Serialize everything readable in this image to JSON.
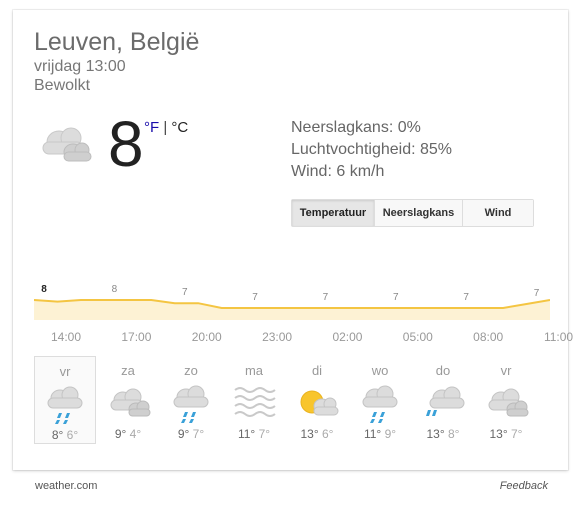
{
  "location": "Leuven, België",
  "datetime": "vrijdag 13:00",
  "condition": "Bewolkt",
  "current": {
    "icon": "cloudy-icon",
    "temperature": "8",
    "unit_f": "°F",
    "unit_sep": " | ",
    "unit_c": "°C"
  },
  "details": {
    "precipitation": "Neerslagkans: 0%",
    "humidity": "Luchtvochtigheid: 85%",
    "wind": "Wind: 6 km/h"
  },
  "tabs": [
    "Temperatuur",
    "Neerslagkans",
    "Wind"
  ],
  "active_tab": "Temperatuur",
  "chart_data": {
    "type": "area",
    "title": "",
    "x": [
      "14:00",
      "15:00",
      "16:00",
      "17:00",
      "18:00",
      "19:00",
      "20:00",
      "21:00",
      "22:00",
      "23:00",
      "00:00",
      "01:00",
      "02:00",
      "03:00",
      "04:00",
      "05:00",
      "06:00",
      "07:00",
      "08:00",
      "09:00",
      "10:00",
      "11:00",
      "12:00"
    ],
    "values": [
      8,
      7.8,
      8,
      8,
      8,
      8,
      7.6,
      7.6,
      7,
      7,
      7,
      7,
      7,
      7,
      7,
      7,
      7,
      7,
      7,
      7,
      7,
      7.5,
      8
    ],
    "labels": [
      {
        "x": "14:00",
        "text": "8"
      },
      {
        "x": "17:00",
        "text": "8"
      },
      {
        "x": "20:00",
        "text": "7"
      },
      {
        "x": "23:00",
        "text": "7"
      },
      {
        "x": "02:00",
        "text": "7"
      },
      {
        "x": "05:00",
        "text": "7"
      },
      {
        "x": "08:00",
        "text": "7"
      },
      {
        "x": "11:00",
        "text": "7"
      }
    ],
    "ticks": [
      "14:00",
      "17:00",
      "20:00",
      "23:00",
      "02:00",
      "05:00",
      "08:00",
      "11:00"
    ],
    "line_color": "#f4c542",
    "fill_color": "#fdf2d4"
  },
  "forecast": [
    {
      "day": "vr",
      "icon": "rain-icon",
      "hi": "8°",
      "lo": "6°"
    },
    {
      "day": "za",
      "icon": "cloudy-icon",
      "hi": "9°",
      "lo": "4°"
    },
    {
      "day": "zo",
      "icon": "rain-icon",
      "hi": "9°",
      "lo": "7°"
    },
    {
      "day": "ma",
      "icon": "fog-icon",
      "hi": "11°",
      "lo": "7°"
    },
    {
      "day": "di",
      "icon": "partly-sunny-icon",
      "hi": "13°",
      "lo": "6°"
    },
    {
      "day": "wo",
      "icon": "rain-icon",
      "hi": "11°",
      "lo": "9°"
    },
    {
      "day": "do",
      "icon": "rain-cloudy-icon",
      "hi": "13°",
      "lo": "8°"
    },
    {
      "day": "vr",
      "icon": "cloudy-icon",
      "hi": "13°",
      "lo": "7°"
    }
  ],
  "source": "weather.com",
  "feedback": "Feedback"
}
